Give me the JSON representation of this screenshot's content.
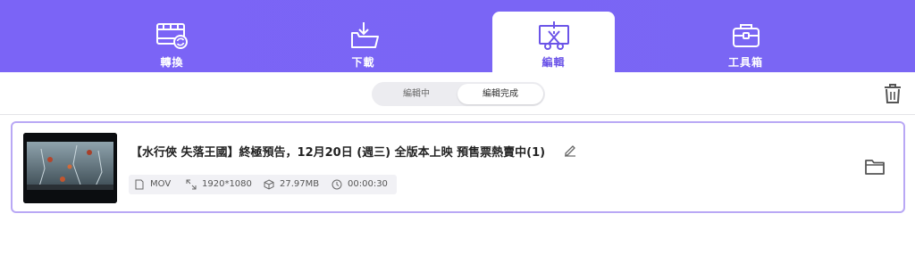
{
  "nav": {
    "tabs": [
      {
        "label": "轉換",
        "icon": "convert-film-icon",
        "active": false
      },
      {
        "label": "下載",
        "icon": "download-tray-icon",
        "active": false
      },
      {
        "label": "編輯",
        "icon": "edit-cut-icon",
        "active": true
      },
      {
        "label": "工具箱",
        "icon": "toolbox-icon",
        "active": false
      }
    ],
    "accent": "#7b64f6"
  },
  "subbar": {
    "segments": [
      "編輯中",
      "編輯完成"
    ],
    "selected": "編輯完成",
    "trash_icon": "trash-icon"
  },
  "file": {
    "title": "【水行俠 失落王國】終極預告，12月20日 (週三) 全版本上映 預售票熱賣中(1)",
    "format": "MOV",
    "resolution": "1920*1080",
    "size": "27.97MB",
    "duration": "00:00:30",
    "edit_icon": "pencil-icon",
    "open_folder_icon": "folder-icon"
  }
}
